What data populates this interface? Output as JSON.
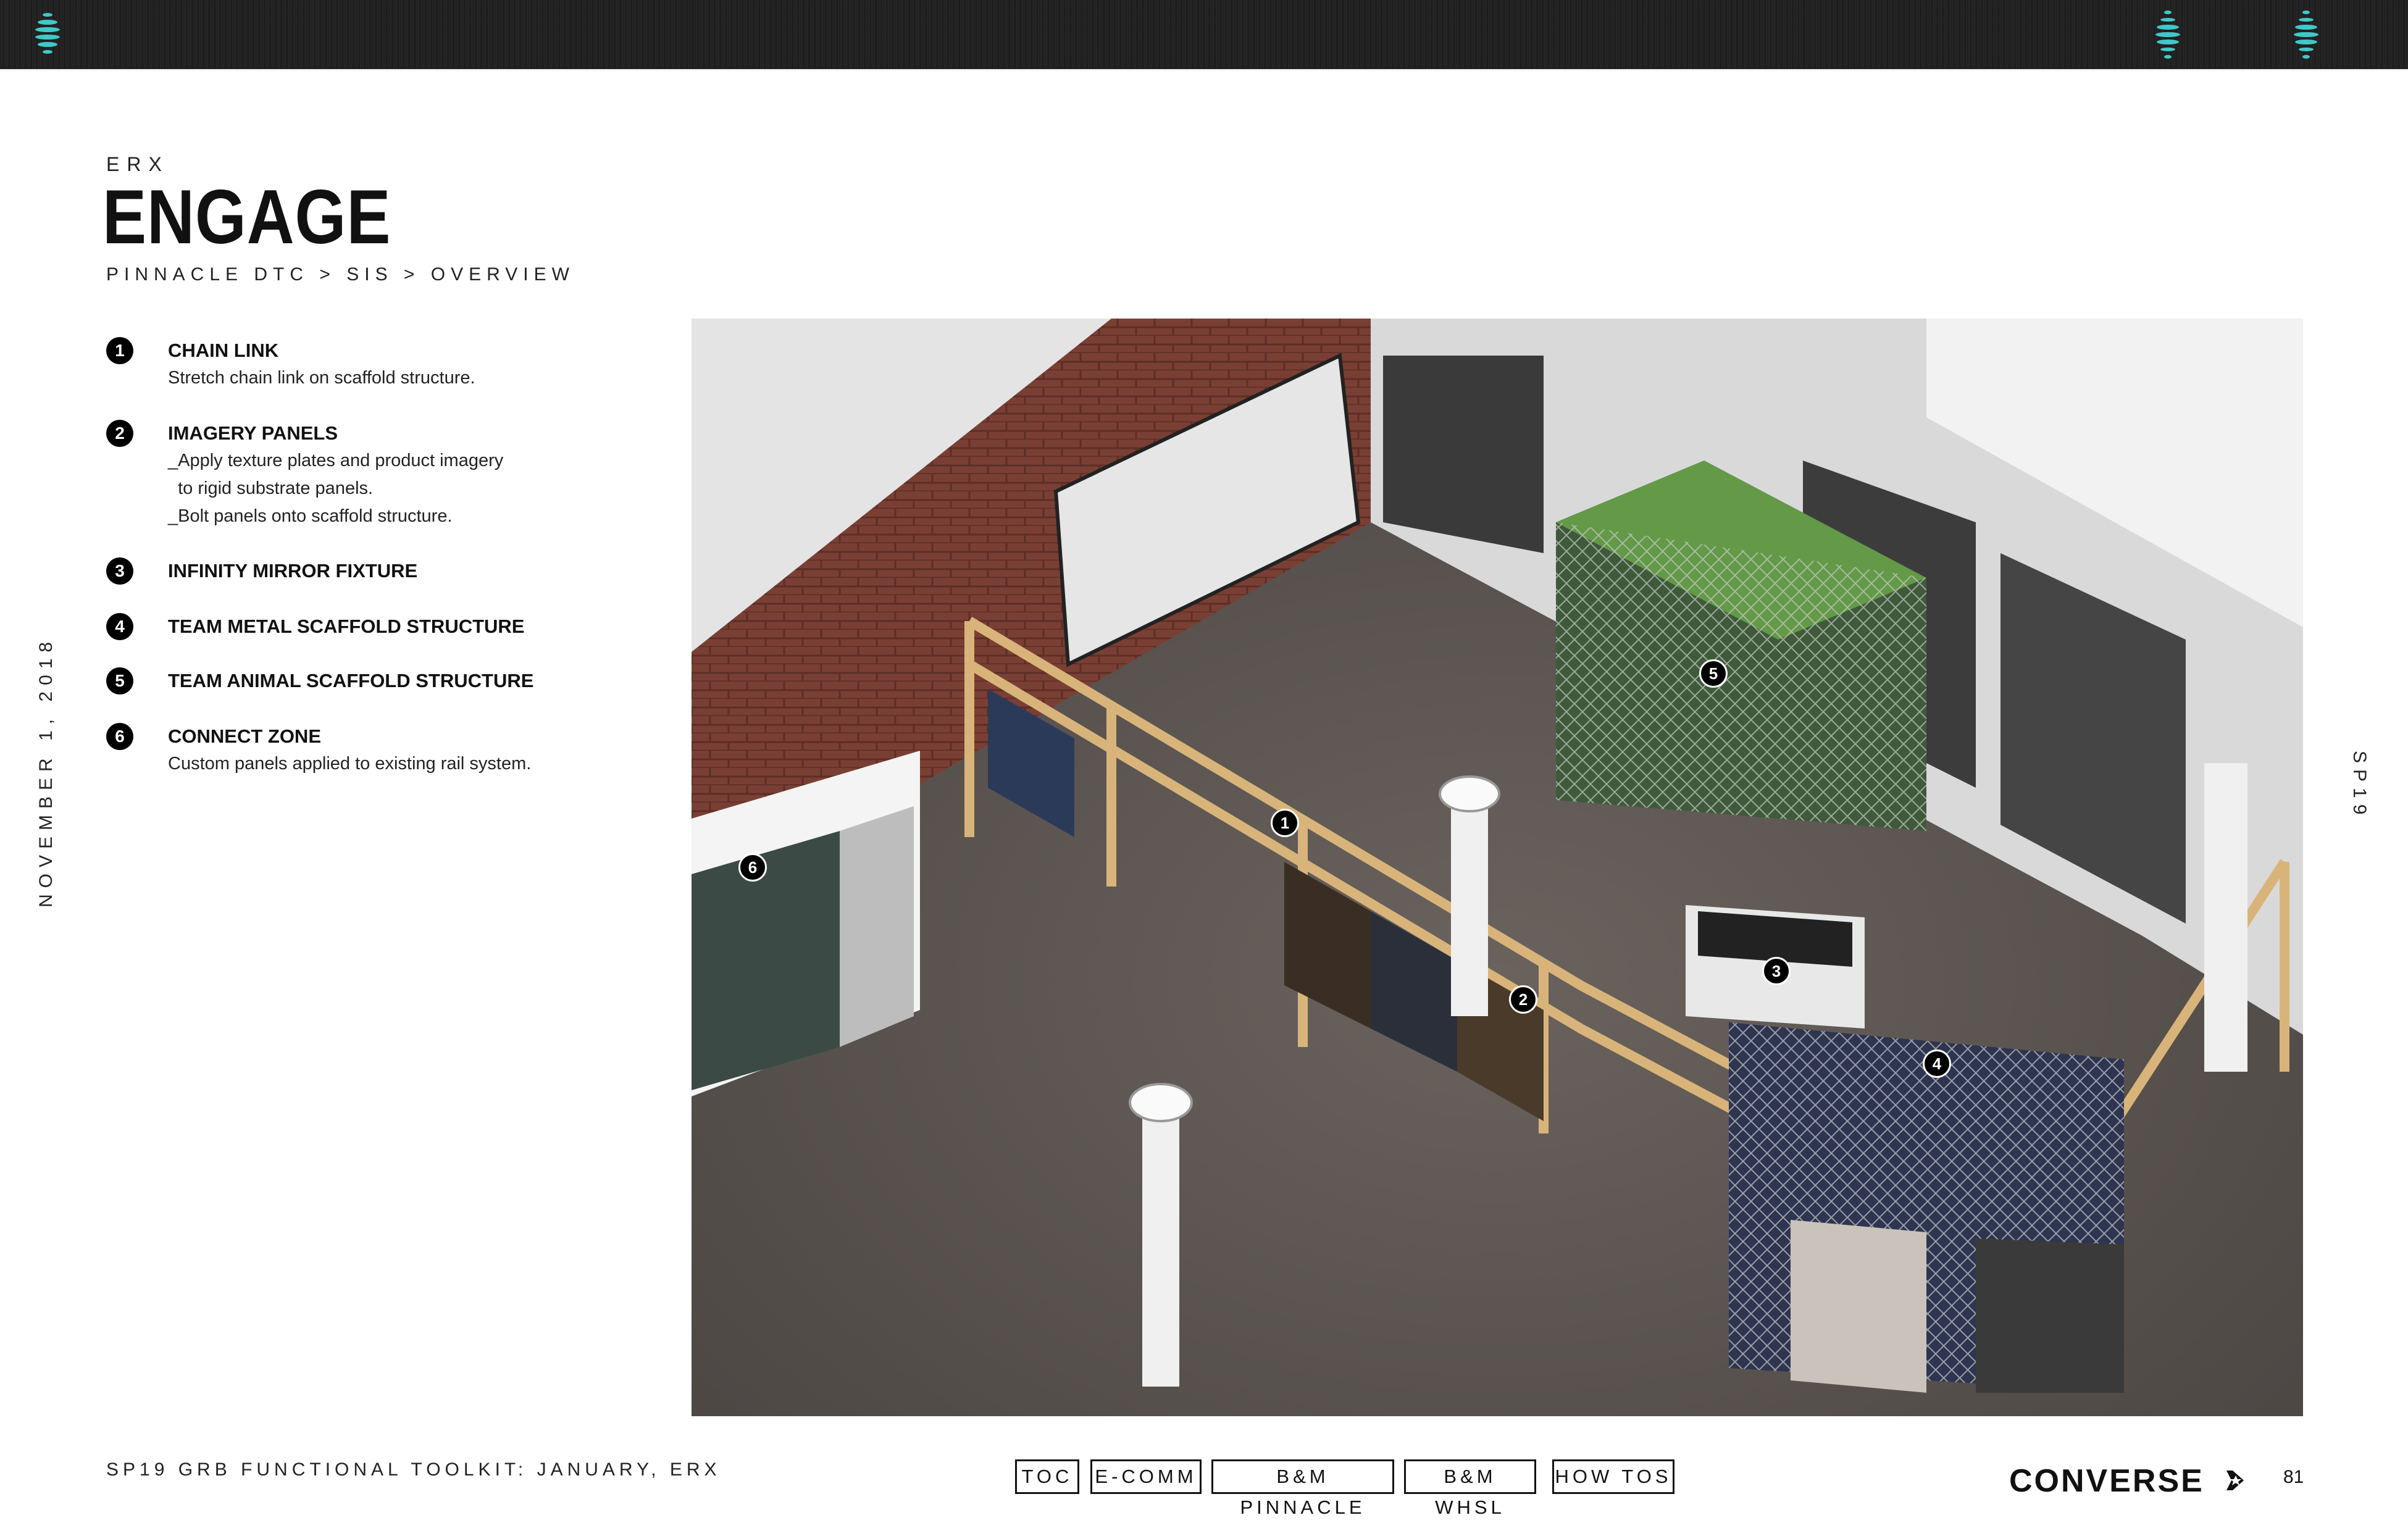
{
  "header": {
    "eyebrow": "ERX",
    "title": "ENGAGE",
    "breadcrumb": "PINNACLE DTC > SIS > OVERVIEW"
  },
  "legend": [
    {
      "num": "1",
      "title": "CHAIN LINK",
      "desc": "Stretch chain link on scaffold structure."
    },
    {
      "num": "2",
      "title": "IMAGERY PANELS",
      "desc": "_Apply texture plates and product imagery\n  to rigid substrate panels.\n_Bolt panels onto scaffold structure."
    },
    {
      "num": "3",
      "title": "INFINITY MIRROR FIXTURE",
      "desc": ""
    },
    {
      "num": "4",
      "title": "TEAM METAL SCAFFOLD STRUCTURE",
      "desc": ""
    },
    {
      "num": "5",
      "title": "TEAM ANIMAL SCAFFOLD STRUCTURE",
      "desc": ""
    },
    {
      "num": "6",
      "title": "CONNECT ZONE",
      "desc": "Custom panels applied to existing rail system."
    }
  ],
  "side": {
    "date": "NOVEMBER 1, 2018",
    "season": "SP19"
  },
  "rendering": {
    "markers": [
      "1",
      "2",
      "3",
      "4",
      "5",
      "6"
    ]
  },
  "footer": {
    "toolkit": "SP19 GRB FUNCTIONAL TOOLKIT: JANUARY, ERX",
    "nav": [
      "TOC",
      "E-COMM",
      "B&M PINNACLE",
      "B&M WHSL",
      "HOW TOS"
    ],
    "brand": "CONVERSE",
    "page": "81"
  },
  "colors": {
    "topbar": "#222222",
    "accent": "#3fc9c9",
    "wood": "#d9b47a",
    "brick": "#7a3f34",
    "floor": "#5c5652"
  },
  "icons": [
    "wave-icon",
    "converse-star-icon"
  ]
}
